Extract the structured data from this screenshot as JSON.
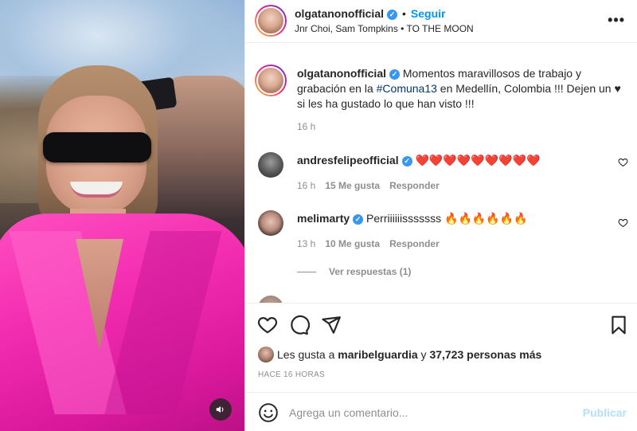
{
  "media": {
    "audio_icon": "speaker-icon"
  },
  "header": {
    "username": "olgatanonofficial",
    "verified_mark": "✓",
    "separator": "•",
    "follow_label": "Seguir",
    "subtitle": "Jnr Choi, Sam Tompkins • TO THE MOON",
    "more_label": "•••"
  },
  "caption": {
    "username": "olgatanonofficial",
    "text_before": "Momentos maravillosos de trabajo y grabación en la ",
    "hashtag": "#Comuna13",
    "text_after": " en Medellín, Colombia !!! Dejen un ♥ si les ha gustado lo que han visto !!!",
    "time": "16 h"
  },
  "comments": [
    {
      "username": "andresfelipeofficial",
      "text": "❤️❤️❤️❤️❤️❤️❤️❤️❤️",
      "time": "16 h",
      "likes": "15 Me gusta",
      "reply": "Responder"
    },
    {
      "username": "melimarty",
      "text": "Perriiiiiisssssss 🔥🔥🔥🔥🔥🔥",
      "time": "13 h",
      "likes": "10 Me gusta",
      "reply": "Responder",
      "view_replies": "Ver respuestas (1)"
    }
  ],
  "actions": {
    "like_icon": "heart-icon",
    "comment_icon": "comment-icon",
    "share_icon": "share-icon",
    "save_icon": "bookmark-icon",
    "liked_prefix": "Les gusta a ",
    "liked_user": "maribelguardia",
    "liked_connector": " y ",
    "liked_count": "37,723 personas más",
    "timeago": "HACE 16 HORAS"
  },
  "add_comment": {
    "placeholder": "Agrega un comentario...",
    "publish_label": "Publicar"
  },
  "colors": {
    "accent": "#0095f6",
    "verified": "#3897f0",
    "publish_disabled": "#b2dffc",
    "jacket": "#f22bb0"
  }
}
